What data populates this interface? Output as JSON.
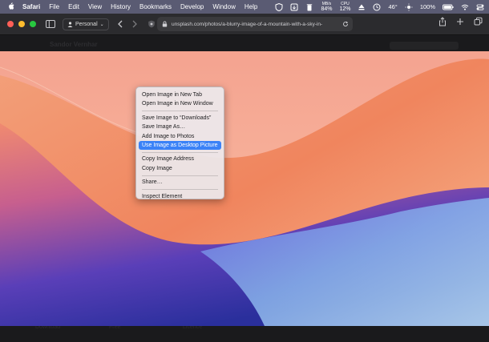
{
  "menubar": {
    "app": "Safari",
    "items": [
      "File",
      "Edit",
      "View",
      "History",
      "Bookmarks",
      "Develop",
      "Window",
      "Help"
    ],
    "status": {
      "network_top": "MB/s",
      "network_value": "84%",
      "cpu_top": "CPU",
      "cpu_value": "12%",
      "temperature": "46°",
      "battery": "100%"
    }
  },
  "toolbar": {
    "profile_label": "Personal",
    "url": "unsplash.com/photos/a-blurry-image-of-a-mountain-with-a-sky-in-"
  },
  "page": {
    "ghost_title": "Sandor Vernhar",
    "ghost_bottom_1": "Download",
    "ghost_bottom_2": "Free",
    "ghost_bottom_3": "Licence"
  },
  "context_menu": {
    "groups": [
      [
        "Open Image in New Tab",
        "Open Image in New Window"
      ],
      [
        "Save Image to “Downloads”",
        "Save Image As…",
        "Add Image to Photos",
        "Use Image as Desktop Picture"
      ],
      [
        "Copy Image Address",
        "Copy Image"
      ],
      [
        "Share…"
      ],
      [
        "Inspect Element"
      ]
    ],
    "highlighted": "Use Image as Desktop Picture"
  },
  "colors": {
    "menu_highlight": "#3a82f7",
    "menubar_bg": "#5a5b73"
  }
}
